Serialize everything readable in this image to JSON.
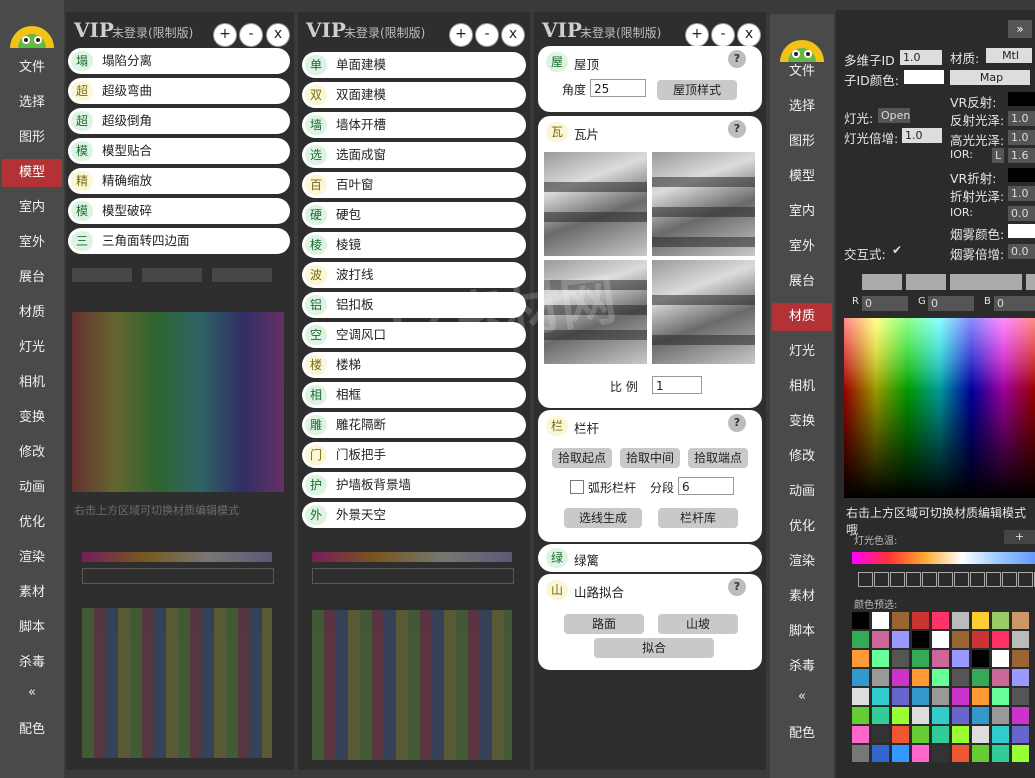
{
  "sidebar_left": {
    "items": [
      "文件",
      "选择",
      "图形",
      "模型",
      "室内",
      "室外",
      "展台",
      "材质",
      "灯光",
      "相机",
      "变换",
      "修改",
      "动画",
      "优化",
      "渲染",
      "素材",
      "脚本",
      "杀毒"
    ],
    "collapse": "«",
    "bottom": "配色",
    "active_index": 3
  },
  "sidebar_right": {
    "items": [
      "文件",
      "选择",
      "图形",
      "模型",
      "室内",
      "室外",
      "展台",
      "材质",
      "灯光",
      "相机",
      "变换",
      "修改",
      "动画",
      "优化",
      "渲染",
      "素材",
      "脚本",
      "杀毒"
    ],
    "collapse": "«",
    "bottom": "配色",
    "active_index": 7
  },
  "panel_header": {
    "vip": "VIP",
    "status": "未登录(限制版)",
    "add": "+",
    "minus": "-",
    "close": "x"
  },
  "panel1": {
    "items": [
      {
        "icon": "塌",
        "label": "塌陷分离"
      },
      {
        "icon": "超",
        "label": "超级弯曲"
      },
      {
        "icon": "超",
        "label": "超级倒角"
      },
      {
        "icon": "模",
        "label": "模型贴合"
      },
      {
        "icon": "精",
        "label": "精确缩放"
      },
      {
        "icon": "模",
        "label": "模型破碎"
      },
      {
        "icon": "三",
        "label": "三角面转四边面"
      }
    ],
    "hint": "右击上方区域可切换材质编辑模式"
  },
  "panel2": {
    "items": [
      {
        "icon": "单",
        "label": "单面建模"
      },
      {
        "icon": "双",
        "label": "双面建模"
      },
      {
        "icon": "墙",
        "label": "墙体开槽"
      },
      {
        "icon": "选",
        "label": "选面成窗"
      },
      {
        "icon": "百",
        "label": "百叶窗"
      },
      {
        "icon": "硬",
        "label": "硬包"
      },
      {
        "icon": "棱",
        "label": "棱镜"
      },
      {
        "icon": "波",
        "label": "波打线"
      },
      {
        "icon": "铝",
        "label": "铝扣板"
      },
      {
        "icon": "空",
        "label": "空调风口"
      },
      {
        "icon": "楼",
        "label": "楼梯"
      },
      {
        "icon": "相",
        "label": "相框"
      },
      {
        "icon": "雕",
        "label": "雕花隔断"
      },
      {
        "icon": "门",
        "label": "门板把手"
      },
      {
        "icon": "护",
        "label": "护墙板背景墙"
      },
      {
        "icon": "外",
        "label": "外景天空"
      }
    ]
  },
  "panel3": {
    "roof": {
      "icon": "屋",
      "title": "屋顶",
      "help": "?",
      "angle_label": "角度",
      "angle_value": "25",
      "style_button": "屋顶样式"
    },
    "tile": {
      "icon": "瓦",
      "title": "瓦片",
      "help": "?",
      "scale_label": "比 例",
      "scale_value": "1"
    },
    "railing": {
      "icon": "栏",
      "title": "栏杆",
      "help": "?",
      "pick_start": "拾取起点",
      "pick_middle": "拾取中间",
      "pick_end": "拾取端点",
      "arc_label": "弧形栏杆",
      "segments_label": "分段",
      "segments_value": "6",
      "generate": "选线生成",
      "library": "栏杆库"
    },
    "fence": {
      "icon": "绿",
      "title": "绿篱"
    },
    "road": {
      "icon": "山",
      "title": "山路拟合",
      "help": "?",
      "road": "路面",
      "slope": "山坡",
      "fit": "拟合"
    }
  },
  "material": {
    "multi_id_label": "多维子ID",
    "multi_id_value": "1.0",
    "material_label": "材质:",
    "mtl_button": "Mtl",
    "sub_id_color_label": "子ID颜色:",
    "map_button": "Map",
    "vr_reflect_label": "VR反射:",
    "light_label": "灯光:",
    "light_button": "Open",
    "reflect_gloss_label": "反射光泽:",
    "reflect_gloss_value": "1.0",
    "light_mult_label": "灯光倍增:",
    "light_mult_value": "1.0",
    "hilight_gloss_label": "高光光泽:",
    "hilight_gloss_value": "1.0",
    "ior_label": "IOR:",
    "ior_lock": "L",
    "ior_value": "1.6",
    "vr_refract_label": "VR折射:",
    "refract_gloss_label": "折射光泽:",
    "refract_gloss_value": "1.0",
    "ior2_label": "IOR:",
    "ior2_value": "0.0",
    "interactive_label": "交互式:",
    "interactive_check": "✔",
    "fog_color_label": "烟雾颜色:",
    "fog_mult_label": "烟雾倍增:",
    "fog_mult_value": "0.0",
    "r_label": "R",
    "r_value": "0",
    "g_label": "G",
    "g_value": "0",
    "b_label": "B",
    "b_value": "0",
    "hint": "右击上方区域可切换材质编辑模式哦",
    "light_color_label": "灯光色温:",
    "light_color_add": "+",
    "preset_label": "颜色预选:",
    "collapse": "»"
  },
  "colors": {
    "accent": "#b23236",
    "panel_bg": "#2e2e2e",
    "sidebar_bg": "#4a4a4a"
  }
}
